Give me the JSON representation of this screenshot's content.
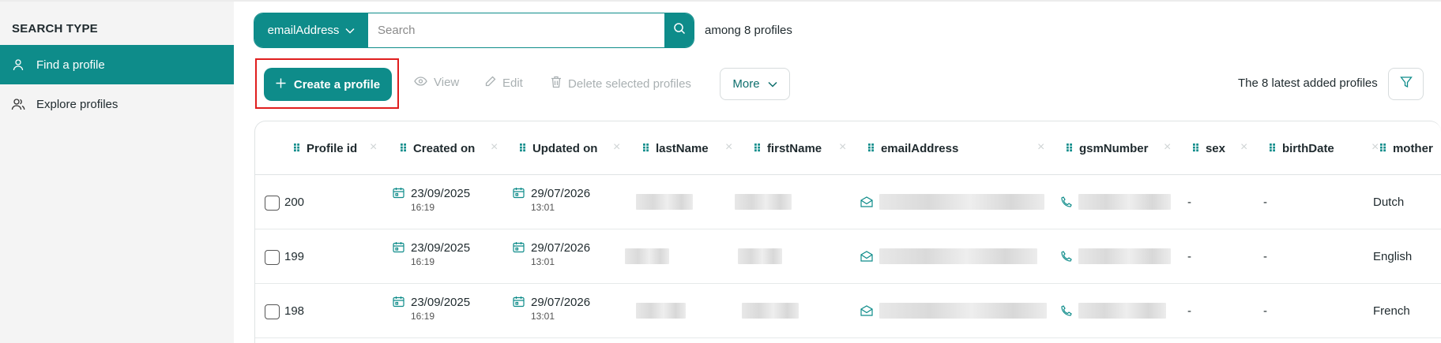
{
  "sidebar": {
    "title": "SEARCH TYPE",
    "items": [
      {
        "label": "Find a profile",
        "icon": "user-icon",
        "active": true
      },
      {
        "label": "Explore profiles",
        "icon": "users-icon",
        "active": false
      }
    ]
  },
  "search": {
    "type_label": "emailAddress",
    "placeholder": "Search",
    "value": "",
    "count_text": "among 8 profiles"
  },
  "toolbar": {
    "create_label": "Create a profile",
    "view_label": "View",
    "edit_label": "Edit",
    "delete_label": "Delete selected profiles",
    "more_label": "More",
    "latest_text": "The 8 latest added profiles"
  },
  "table": {
    "columns": [
      "Profile id",
      "Created on",
      "Updated on",
      "lastName",
      "firstName",
      "emailAddress",
      "gsmNumber",
      "sex",
      "birthDate",
      "mother"
    ],
    "rows": [
      {
        "id": "200",
        "created_date": "23/09/2025",
        "created_time": "16:19",
        "updated_date": "29/07/2026",
        "updated_time": "13:01",
        "sex": "-",
        "birthDate": "-",
        "mother": "Dutch"
      },
      {
        "id": "199",
        "created_date": "23/09/2025",
        "created_time": "16:19",
        "updated_date": "29/07/2026",
        "updated_time": "13:01",
        "sex": "-",
        "birthDate": "-",
        "mother": "English"
      },
      {
        "id": "198",
        "created_date": "23/09/2025",
        "created_time": "16:19",
        "updated_date": "29/07/2026",
        "updated_time": "13:01",
        "sex": "-",
        "birthDate": "-",
        "mother": "French"
      }
    ]
  },
  "colors": {
    "accent": "#0e8c8a",
    "highlight": "#e01e1e",
    "disabled": "#a9b0b2"
  }
}
